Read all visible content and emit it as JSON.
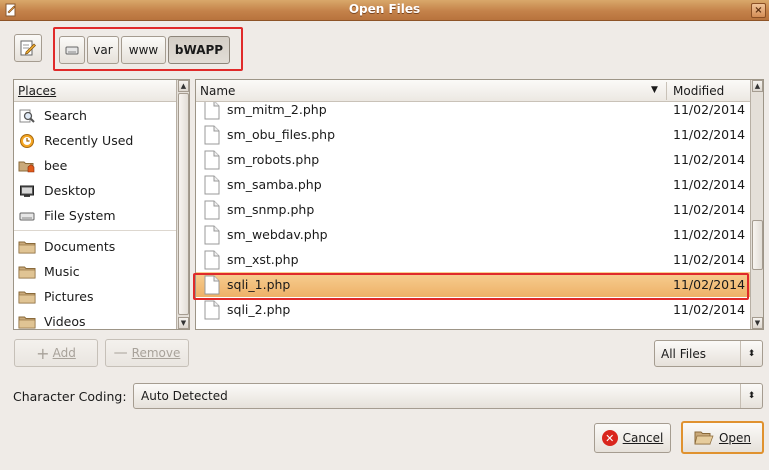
{
  "window": {
    "title": "Open Files",
    "close_glyph": "×"
  },
  "toolbar": {
    "edit_location_icon": "edit-location-icon"
  },
  "path_bar": {
    "segments": [
      {
        "label": "",
        "icon": "drive-icon"
      },
      {
        "label": "var"
      },
      {
        "label": "www"
      },
      {
        "label": "bWAPP",
        "active": true
      }
    ]
  },
  "places": {
    "header": "Places",
    "items": [
      {
        "label": "Search",
        "icon": "search-icon"
      },
      {
        "label": "Recently Used",
        "icon": "recent-icon"
      },
      {
        "label": "bee",
        "icon": "home-folder-icon"
      },
      {
        "label": "Desktop",
        "icon": "desktop-icon"
      },
      {
        "label": "File System",
        "icon": "drive-icon"
      },
      {
        "label": "Documents",
        "icon": "folder-icon"
      },
      {
        "label": "Music",
        "icon": "folder-icon"
      },
      {
        "label": "Pictures",
        "icon": "folder-icon"
      },
      {
        "label": "Videos",
        "icon": "folder-icon"
      }
    ],
    "add_label": "Add",
    "remove_label": "Remove"
  },
  "files": {
    "columns": {
      "name": "Name",
      "modified": "Modified"
    },
    "rows": [
      {
        "name": "sm_mitm_2.php",
        "modified": "11/02/2014"
      },
      {
        "name": "sm_obu_files.php",
        "modified": "11/02/2014"
      },
      {
        "name": "sm_robots.php",
        "modified": "11/02/2014"
      },
      {
        "name": "sm_samba.php",
        "modified": "11/02/2014"
      },
      {
        "name": "sm_snmp.php",
        "modified": "11/02/2014"
      },
      {
        "name": "sm_webdav.php",
        "modified": "11/02/2014"
      },
      {
        "name": "sm_xst.php",
        "modified": "11/02/2014"
      },
      {
        "name": "sqli_1.php",
        "modified": "11/02/2014",
        "selected": true
      },
      {
        "name": "sqli_2.php",
        "modified": "11/02/2014"
      }
    ]
  },
  "filter": {
    "value": "All Files"
  },
  "character_coding": {
    "label": "Character Coding:",
    "value": "Auto Detected"
  },
  "actions": {
    "cancel_label": "Cancel",
    "open_label": "Open"
  },
  "colors": {
    "titlebar": "#c4824a",
    "selection": "#f2bd7a",
    "highlight_box": "#e02a2a"
  }
}
